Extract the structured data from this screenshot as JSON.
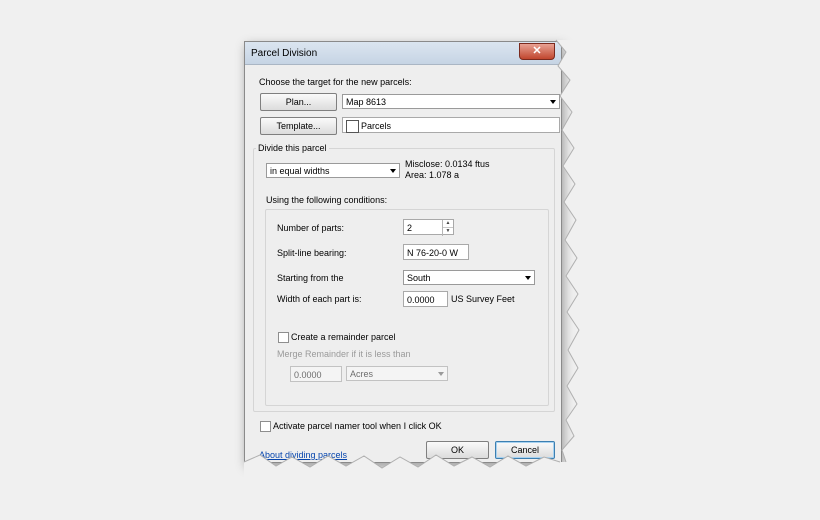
{
  "dialog": {
    "title": "Parcel Division",
    "close_glyph": "✕"
  },
  "target": {
    "label": "Choose the target for the new parcels:",
    "plan_button": "Plan...",
    "plan_value": "Map 8613",
    "template_button": "Template...",
    "template_value": "Parcels"
  },
  "divide": {
    "group_label": "Divide this parcel",
    "method_value": "in equal widths",
    "misclose": "Misclose: 0.0134 ftus",
    "area": "Area: 1.078 a"
  },
  "conditions": {
    "label": "Using the following conditions:",
    "parts_label": "Number of parts:",
    "parts_value": "2",
    "bearing_label": "Split-line bearing:",
    "bearing_value": "N 76-20-0 W",
    "start_label": "Starting from the",
    "start_value": "South",
    "width_label": "Width of each part is:",
    "width_value": "0.0000",
    "width_unit": "US Survey Feet",
    "remainder_label": "Create a remainder parcel",
    "remainder_checked": false,
    "merge_label": "Merge Remainder if it is less than",
    "merge_value": "0.0000",
    "merge_unit": "Acres"
  },
  "footer": {
    "activate_label": "Activate parcel namer tool when I click OK",
    "activate_checked": false,
    "about_link": "About dividing parcels",
    "ok_button": "OK",
    "cancel_button": "Cancel"
  }
}
